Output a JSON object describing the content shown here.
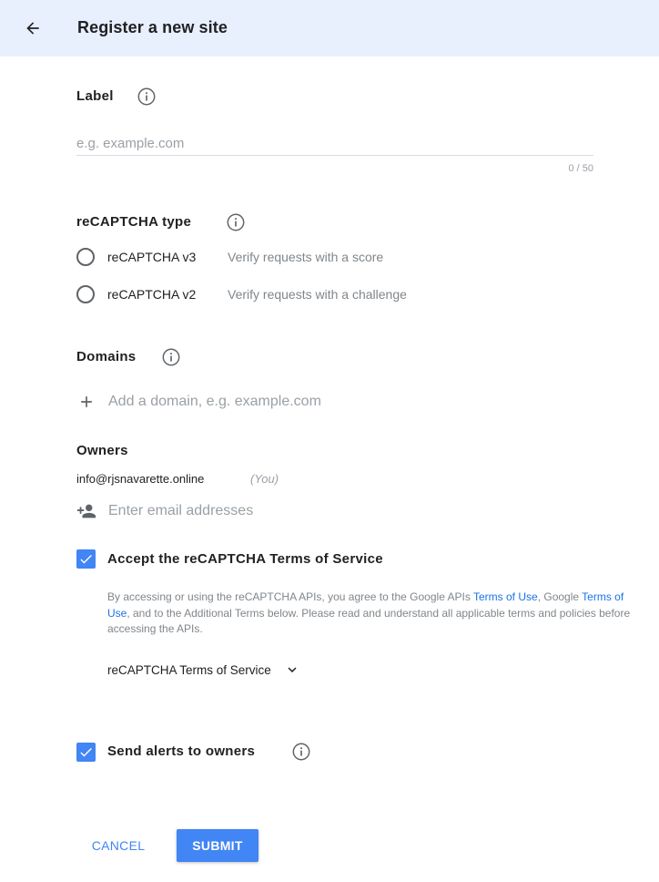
{
  "header": {
    "title": "Register a new site",
    "back_icon": "arrow-back-icon"
  },
  "label_section": {
    "title": "Label",
    "placeholder": "e.g. example.com",
    "value": "",
    "char_count": "0 / 50"
  },
  "type_section": {
    "title": "reCAPTCHA type",
    "options": [
      {
        "label": "reCAPTCHA v3",
        "description": "Verify requests with a score",
        "selected": false
      },
      {
        "label": "reCAPTCHA v2",
        "description": "Verify requests with a challenge",
        "selected": false
      }
    ]
  },
  "domains_section": {
    "title": "Domains",
    "placeholder": "Add a domain, e.g. example.com"
  },
  "owners_section": {
    "title": "Owners",
    "email": "info@rjsnavarette.online",
    "you_label": "(You)",
    "placeholder": "Enter email addresses"
  },
  "terms": {
    "checked": true,
    "label": "Accept the reCAPTCHA Terms of Service",
    "text_1": "By accessing or using the reCAPTCHA APIs, you agree to the Google APIs ",
    "link_1": "Terms of Use",
    "text_2": ", Google ",
    "link_2": "Terms of Use",
    "text_3": ", and to the Additional Terms below. Please read and understand all applicable terms and policies before accessing the APIs.",
    "dropdown_label": "reCAPTCHA Terms of Service"
  },
  "alerts": {
    "checked": true,
    "label": "Send alerts to owners"
  },
  "actions": {
    "cancel_label": "CANCEL",
    "submit_label": "SUBMIT"
  },
  "colors": {
    "header_bg": "#e8f0fe",
    "accent": "#4285f4",
    "link": "#1a73e8"
  }
}
